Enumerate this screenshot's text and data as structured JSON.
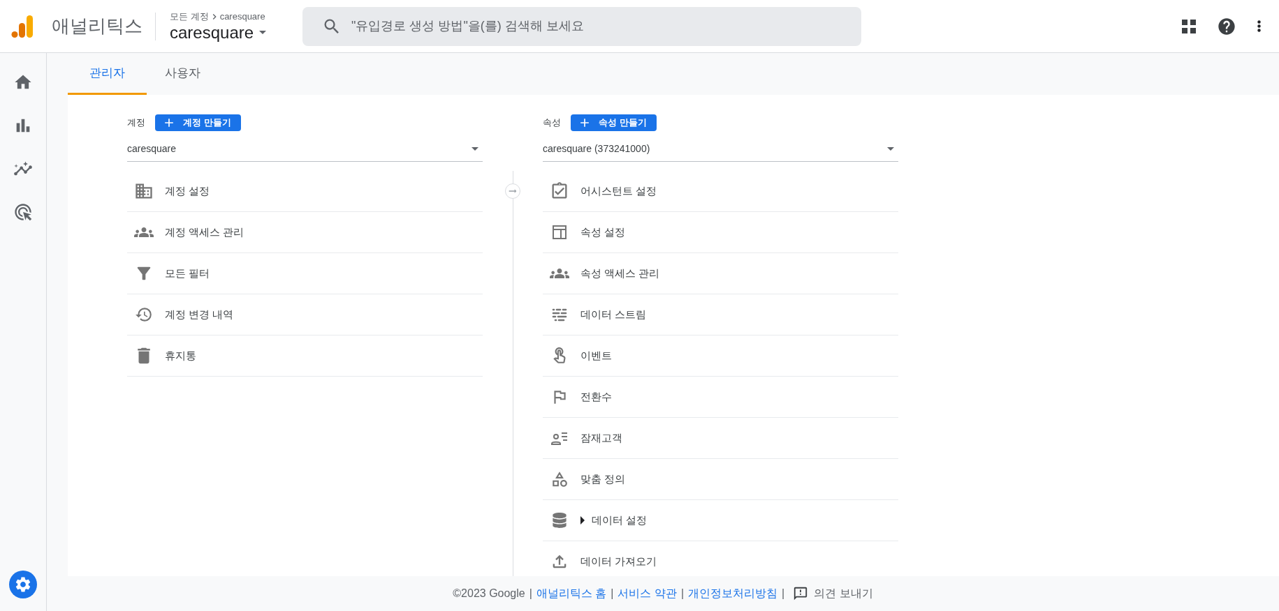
{
  "header": {
    "product": "애널리틱스",
    "breadcrumb": {
      "parent": "모든 계정",
      "current": "caresquare"
    },
    "property": "caresquare",
    "search": {
      "placeholder": "\"유입경로 생성 방법\"을(를) 검색해 보세요"
    }
  },
  "tabs": [
    {
      "label": "관리자",
      "selected": true
    },
    {
      "label": "사용자",
      "selected": false
    }
  ],
  "account": {
    "label": "계정",
    "button": "계정 만들기",
    "selector": "caresquare",
    "items": [
      {
        "label": "계정 설정",
        "kind": "link"
      },
      {
        "label": "계정 액세스 관리",
        "kind": "link"
      },
      {
        "label": "모든 필터",
        "kind": "link"
      },
      {
        "label": "계정 변경 내역",
        "kind": "link"
      },
      {
        "label": "휴지통",
        "kind": "link"
      }
    ]
  },
  "property": {
    "label": "속성",
    "button": "속성 만들기",
    "selector": "caresquare (373241000)",
    "items": [
      {
        "label": "어시스턴트 설정",
        "kind": "link"
      },
      {
        "label": "속성 설정",
        "kind": "link"
      },
      {
        "label": "속성 액세스 관리",
        "kind": "link"
      },
      {
        "label": "데이터 스트림",
        "kind": "link"
      },
      {
        "label": "이벤트",
        "kind": "link"
      },
      {
        "label": "전환수",
        "kind": "link"
      },
      {
        "label": "잠재고객",
        "kind": "link"
      },
      {
        "label": "맞춤 정의",
        "kind": "link"
      },
      {
        "label": "데이터 설정",
        "kind": "group",
        "expanded": false
      },
      {
        "label": "데이터 가져오기",
        "kind": "link"
      }
    ]
  },
  "footer": [
    {
      "text": "©2023 Google",
      "kind": "plain"
    },
    {
      "text": "|",
      "kind": "separator"
    },
    {
      "text": "애널리틱스 홈",
      "kind": "link"
    },
    {
      "text": "|",
      "kind": "separator"
    },
    {
      "text": "서비스 약관",
      "kind": "link"
    },
    {
      "text": "|",
      "kind": "separator"
    },
    {
      "text": "개인정보처리방침",
      "kind": "link"
    },
    {
      "text": "|",
      "kind": "separator"
    },
    {
      "text": "의견 보내기",
      "kind": "feedback"
    }
  ]
}
